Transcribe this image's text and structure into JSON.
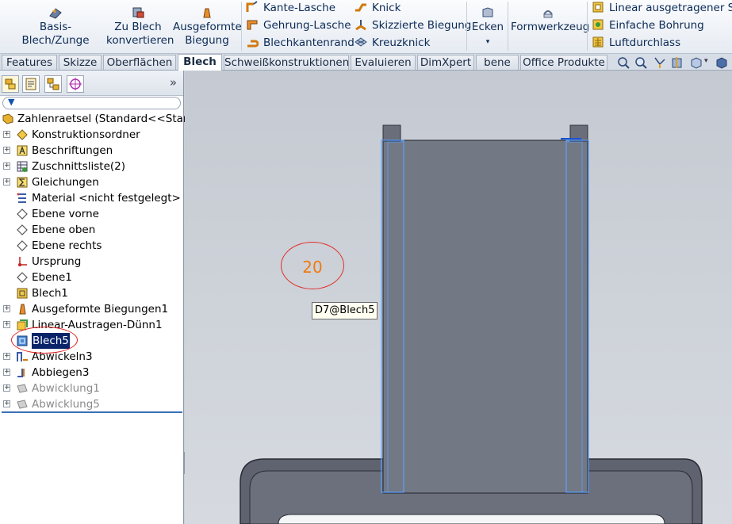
{
  "ribbon": {
    "big_buttons": [
      {
        "name": "basis-blech-zunge-button",
        "label": "Basis-Blech/Zunge"
      },
      {
        "name": "zu-blech-konvertieren-button",
        "line1": "Zu Blech",
        "line2": "konvertieren"
      },
      {
        "name": "ausgeformte-biegung-button",
        "line1": "Ausgeformte",
        "line2": "Biegung"
      }
    ],
    "col1": [
      "Kante-Lasche",
      "Gehrung-Lasche",
      "Blechkantenrand"
    ],
    "col2": [
      "Knick",
      "Skizzierte Biegung",
      "Kreuzknick"
    ],
    "ecken": "Ecken",
    "formwerkzeug": "Formwerkzeug",
    "col3": [
      "Linear ausgetragener Sch",
      "Einfache Bohrung",
      "Luftdurchlass"
    ]
  },
  "tabs": [
    "Features",
    "Skizze",
    "Oberflächen",
    "Blech",
    "Schweißkonstruktionen",
    "Evaluieren",
    "DimXpert",
    "bene",
    "Office Produkte"
  ],
  "active_tab": "Blech",
  "panel": {
    "expand_glyph": "»",
    "root": "Zahlenraetsel  (Standard<<Standa",
    "items": [
      {
        "label": "Konstruktionsordner",
        "icon": "folder-diamond-icon",
        "expandable": true
      },
      {
        "label": "Beschriftungen",
        "icon": "annotation-icon",
        "expandable": true
      },
      {
        "label": "Zuschnittsliste(2)",
        "icon": "cutlist-icon",
        "expandable": true
      },
      {
        "label": "Gleichungen",
        "icon": "equations-icon",
        "expandable": true
      },
      {
        "label": "Material <nicht festgelegt>",
        "icon": "material-icon",
        "expandable": false
      },
      {
        "label": "Ebene vorne",
        "icon": "plane-icon",
        "expandable": false
      },
      {
        "label": "Ebene oben",
        "icon": "plane-icon",
        "expandable": false
      },
      {
        "label": "Ebene rechts",
        "icon": "plane-icon",
        "expandable": false
      },
      {
        "label": "Ursprung",
        "icon": "origin-icon",
        "expandable": false
      },
      {
        "label": "Ebene1",
        "icon": "plane-icon",
        "expandable": false
      },
      {
        "label": "Blech1",
        "icon": "sheetmetal-icon",
        "expandable": false
      },
      {
        "label": "Ausgeformte Biegungen1",
        "icon": "lofted-bend-icon",
        "expandable": true
      },
      {
        "label": "Linear-Austragen-Dünn1",
        "icon": "extrude-icon",
        "expandable": true
      },
      {
        "label": "Blech5",
        "icon": "sheetmetal-icon",
        "expandable": false,
        "selected": true
      },
      {
        "label": "Abwickeln3",
        "icon": "unfold-icon",
        "expandable": true
      },
      {
        "label": "Abbiegen3",
        "icon": "fold-icon",
        "expandable": true
      },
      {
        "label": "Abwicklung1",
        "icon": "flatpattern-icon",
        "expandable": true,
        "suppressed": true
      },
      {
        "label": "Abwicklung5",
        "icon": "flatpattern-icon",
        "expandable": true,
        "suppressed": true
      }
    ]
  },
  "viewport": {
    "dimension_value": "20",
    "tooltip": "D7@Blech5"
  },
  "colors": {
    "accent": "#0a246a",
    "part_fill": "#737885",
    "dimension_text": "#f07a10",
    "highlight_edges": "#5aa0ff"
  }
}
